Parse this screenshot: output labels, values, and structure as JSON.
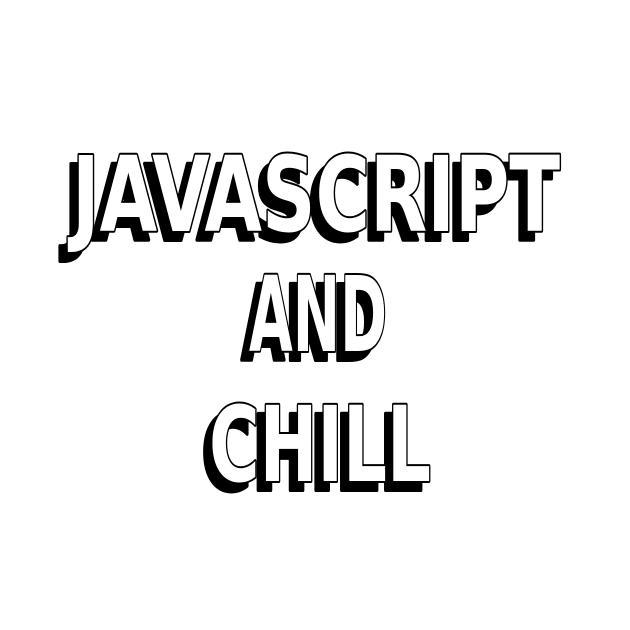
{
  "lines": [
    "JAVASCRIPT",
    "AND",
    "CHILL"
  ],
  "colors": {
    "background": "#ffffff",
    "text_face": "#ffffff",
    "text_outline_and_shadow": "#000000"
  }
}
